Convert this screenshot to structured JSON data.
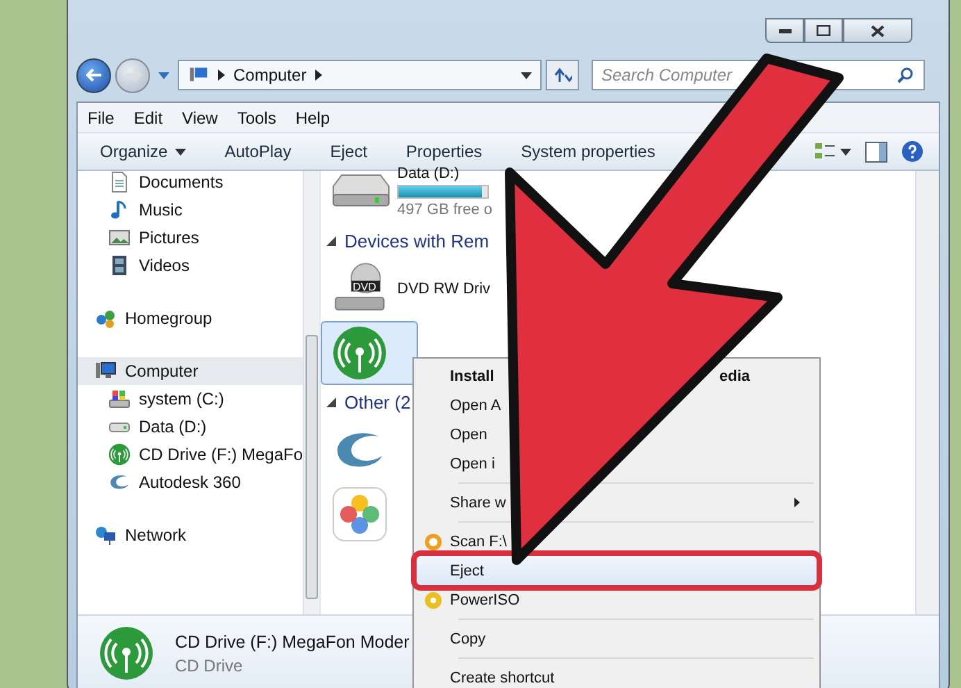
{
  "address_bar": {
    "crumbs": [
      "Computer"
    ]
  },
  "search": {
    "placeholder": "Search Computer"
  },
  "menu_bar": [
    "File",
    "Edit",
    "View",
    "Tools",
    "Help"
  ],
  "toolbar": [
    {
      "label": "Organize",
      "dropdown": true
    },
    {
      "label": "AutoPlay",
      "dropdown": false
    },
    {
      "label": "Eject",
      "dropdown": false
    },
    {
      "label": "Properties",
      "dropdown": false
    },
    {
      "label": "System properties",
      "dropdown": false
    }
  ],
  "sidebar": {
    "sections": [
      {
        "items": [
          {
            "kind": "documents",
            "label": "Documents",
            "selected": false
          },
          {
            "kind": "music",
            "label": "Music",
            "selected": false
          },
          {
            "kind": "pictures",
            "label": "Pictures",
            "selected": false
          },
          {
            "kind": "videos",
            "label": "Videos",
            "selected": false
          }
        ]
      },
      {
        "items": [
          {
            "kind": "homegroup",
            "label": "Homegroup",
            "selected": false
          }
        ]
      },
      {
        "items": [
          {
            "kind": "computer",
            "label": "Computer",
            "selected": true,
            "children": [
              {
                "kind": "system",
                "label": "system (C:)",
                "selected": false
              },
              {
                "kind": "drive",
                "label": "Data (D:)",
                "selected": false
              },
              {
                "kind": "modem",
                "label": "CD Drive (F:) MegaFo",
                "selected": false
              },
              {
                "kind": "autodesk",
                "label": "Autodesk 360",
                "selected": false
              }
            ]
          }
        ]
      },
      {
        "items": [
          {
            "kind": "network",
            "label": "Network",
            "selected": false
          }
        ]
      }
    ]
  },
  "content": {
    "top_items": [
      {
        "kind": "drive",
        "name": "Data (D:)",
        "level": 0.94,
        "free": "497 GB free o",
        "selected": false
      }
    ],
    "groups": [
      {
        "heading": "Devices with Rem",
        "items": [
          {
            "kind": "dvd",
            "badge": "DVD",
            "name": "DVD RW Driv",
            "selected": false
          },
          {
            "kind": "modem",
            "selected": true
          }
        ]
      },
      {
        "heading": "Other (2",
        "items": [
          {
            "kind": "autodesk",
            "selected": false
          },
          {
            "kind": "photos",
            "selected": false
          }
        ]
      }
    ]
  },
  "context_menu": [
    {
      "kind": "item",
      "label": "Install",
      "tail": "edia",
      "bold": true,
      "submenu": false,
      "selected": false,
      "outlined": false
    },
    {
      "kind": "item",
      "label": "Open A",
      "bold": false,
      "submenu": false,
      "selected": false,
      "outlined": false
    },
    {
      "kind": "item",
      "label": "Open",
      "bold": false,
      "submenu": false,
      "selected": false,
      "outlined": false
    },
    {
      "kind": "item",
      "label": "Open i",
      "bold": false,
      "submenu": false,
      "selected": false,
      "outlined": false
    },
    {
      "kind": "separator"
    },
    {
      "kind": "item",
      "label": "Share w",
      "bold": false,
      "submenu": true,
      "selected": false,
      "outlined": false
    },
    {
      "kind": "separator"
    },
    {
      "kind": "scan",
      "label": "Scan F:\\",
      "bold": false,
      "submenu": false,
      "selected": false,
      "outlined": false
    },
    {
      "kind": "item",
      "label": "Eject",
      "bold": false,
      "submenu": false,
      "selected": true,
      "outlined": true
    },
    {
      "kind": "iso",
      "label": "PowerISO",
      "bold": false,
      "submenu": false,
      "selected": false,
      "outlined": false
    },
    {
      "kind": "separator"
    },
    {
      "kind": "item",
      "label": "Copy",
      "bold": false,
      "submenu": false,
      "selected": false,
      "outlined": false
    },
    {
      "kind": "separator"
    },
    {
      "kind": "item",
      "label": "Create shortcut",
      "bold": false,
      "submenu": false,
      "selected": false,
      "outlined": false
    }
  ],
  "details_pane": {
    "title": "CD Drive (F:) MegaFon Moder",
    "subtitle": "CD Drive"
  }
}
